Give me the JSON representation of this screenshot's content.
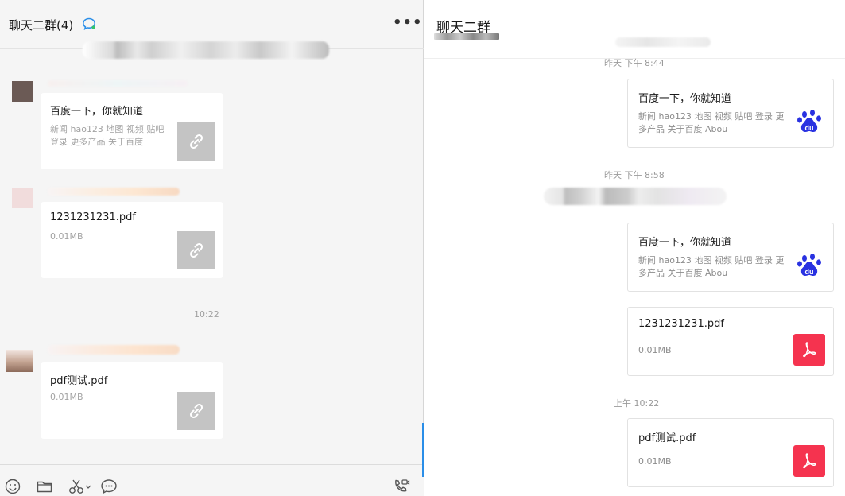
{
  "left": {
    "title": "聊天二群(4)",
    "more_label": "•••",
    "messages": [
      {
        "title": "百度一下，你就知道",
        "desc": "新闻 hao123 地图 视频 贴吧 登录 更多产品 关于百度"
      },
      {
        "title": "1231231231.pdf",
        "size": "0.01MB"
      },
      {
        "title": "pdf测试.pdf",
        "size": "0.01MB"
      }
    ],
    "time": "10:22"
  },
  "right": {
    "title": "聊天二群",
    "timestamps": [
      "昨天 下午 8:44",
      "昨天 下午 8:58",
      "上午 10:22"
    ],
    "cards": [
      {
        "title": "百度一下，你就知道",
        "desc": "新闻 hao123 地图 视频 贴吧 登录 更多产品 关于百度 Abou"
      },
      {
        "title": "百度一下，你就知道",
        "desc": "新闻 hao123 地图 视频 贴吧 登录 更多产品 关于百度 Abou"
      },
      {
        "title": "1231231231.pdf",
        "size": "0.01MB"
      },
      {
        "title": "pdf测试.pdf",
        "size": "0.01MB"
      }
    ]
  },
  "colors": {
    "accent": "#2a8ee8",
    "pdf": "#f5334f",
    "baidu": "#2932e1",
    "link_thumb": "#c4c4c4"
  },
  "icons": [
    "chat-bubble-icon",
    "more-icon",
    "link-icon",
    "baidu-paw-icon",
    "pdf-icon",
    "emoji-icon",
    "folder-icon",
    "scissors-icon",
    "chat-icon",
    "video-call-icon"
  ]
}
